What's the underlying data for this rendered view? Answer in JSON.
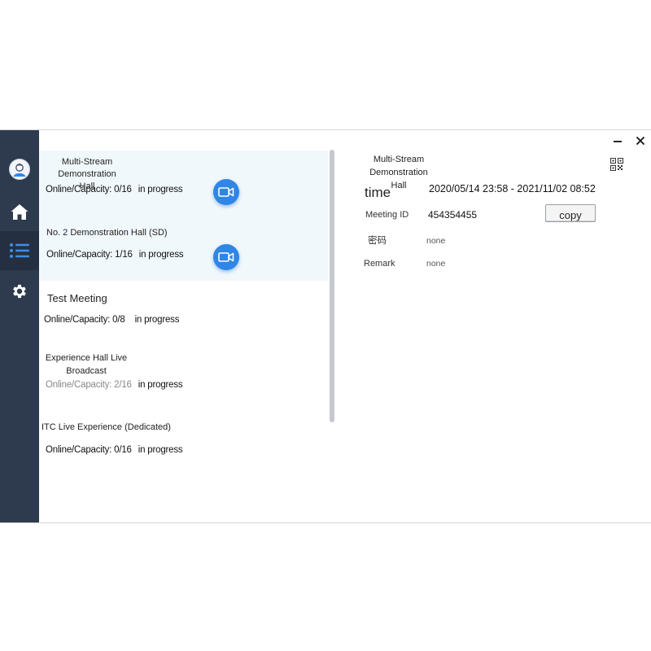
{
  "window": {
    "minimize_icon": "minimize-icon",
    "close_icon": "close-icon"
  },
  "sidebar": {
    "items": [
      {
        "name": "avatar",
        "icon": "user-avatar-icon"
      },
      {
        "name": "home",
        "icon": "home-icon"
      },
      {
        "name": "meeting-list",
        "icon": "list-icon",
        "active": true
      },
      {
        "name": "settings",
        "icon": "gear-icon"
      }
    ],
    "colors": {
      "background": "#2e3a4d",
      "icon": "#ffffff",
      "active_icon": "#3d8de6"
    }
  },
  "rooms": [
    {
      "name_line1": "Multi-Stream Demonstration",
      "name_line2": "Hall",
      "capacity": "Online/Capacity: 0/16",
      "status": "in progress",
      "selected": true,
      "has_video": true
    },
    {
      "name": "No. 2 Demonstration Hall (SD)",
      "capacity": "Online/Capacity: 1/16",
      "status": "in progress",
      "selected": true,
      "has_video": true
    },
    {
      "name": "Test Meeting",
      "capacity": "Online/Capacity: 0/8",
      "status": "in progress"
    },
    {
      "name_line1": "Experience Hall Live",
      "name_line2": "Broadcast",
      "capacity": "Online/Capacity: 2/16",
      "status": "in progress"
    },
    {
      "name": "ITC Live Experience (Dedicated)",
      "capacity": "Online/Capacity: 0/16",
      "status": "in progress"
    }
  ],
  "detail": {
    "title_line1": "Multi-Stream Demonstration",
    "title_line2": "Hall",
    "time_label": "time",
    "time_value": "2020/05/14 23:58 - 2021/11/02 08:52",
    "meeting_id_label": "Meeting ID",
    "meeting_id_value": "454354455",
    "copy_label": "copy",
    "password_label": "密码",
    "password_value": "none",
    "remark_label": "Remark",
    "remark_value": "none",
    "qr_icon": "qr-code-icon"
  },
  "colors": {
    "accent": "#2f86e6",
    "selected_row": "#f1f8fb"
  }
}
